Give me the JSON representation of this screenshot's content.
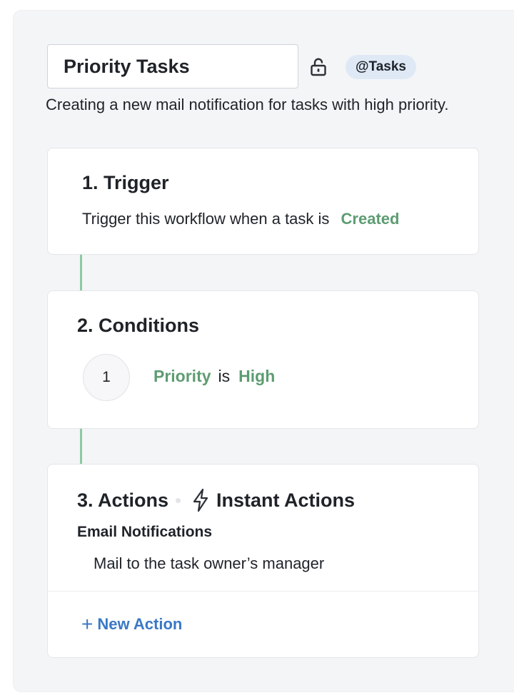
{
  "header": {
    "workflow_name": "Priority Tasks",
    "module_badge": "@Tasks",
    "description": "Creating a new mail notification for tasks with high priority."
  },
  "trigger": {
    "title": "1. Trigger",
    "text": "Trigger this workflow when a task is",
    "event": "Created"
  },
  "conditions": {
    "title": "2. Conditions",
    "items": [
      {
        "number": "1",
        "field": "Priority",
        "operator": "is",
        "value": "High"
      }
    ]
  },
  "actions": {
    "title": "3. Actions",
    "subtitle": "Instant Actions",
    "email_heading": "Email Notifications",
    "items": [
      "Mail to the task owner’s manager"
    ],
    "new_action_label": "New Action",
    "new_action_icon": "plus-icon"
  },
  "icons": {
    "lock": "unlock-icon",
    "bolt": "lightning-bolt-icon"
  },
  "colors": {
    "accent_green": "#5e9c72",
    "connector_green": "#8cc9a2",
    "link_blue": "#3a78c5",
    "badge_bg": "#dfe9f6",
    "panel_bg": "#f4f5f7"
  }
}
